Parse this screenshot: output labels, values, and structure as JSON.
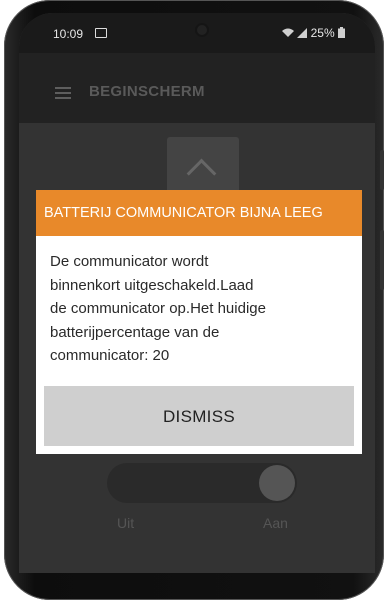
{
  "status_bar": {
    "time": "10:09",
    "battery": "25%",
    "image_icon": "image-icon",
    "signal_icon": "signal-icon",
    "wifi_icon": "wifi-icon",
    "battery_icon": "battery-icon"
  },
  "app_bar": {
    "menu_icon": "hamburger-icon",
    "title": "BEGINSCHERM"
  },
  "background": {
    "up_icon": "chevron-up-icon",
    "toggle_off_label": "Uit",
    "toggle_on_label": "Aan"
  },
  "dialog": {
    "title": "BATTERIJ COMMUNICATOR BIJNA LEEG",
    "message_lines": [
      "De communicator wordt",
      "binnenkort uitgeschakeld.Laad",
      "de communicator op.Het huidige",
      "batterijpercentage van de",
      "communicator: 20"
    ],
    "dismiss_label": "DISMISS"
  },
  "colors": {
    "dialog_header": "#e8892a",
    "dismiss_button": "#cfcfcf"
  }
}
